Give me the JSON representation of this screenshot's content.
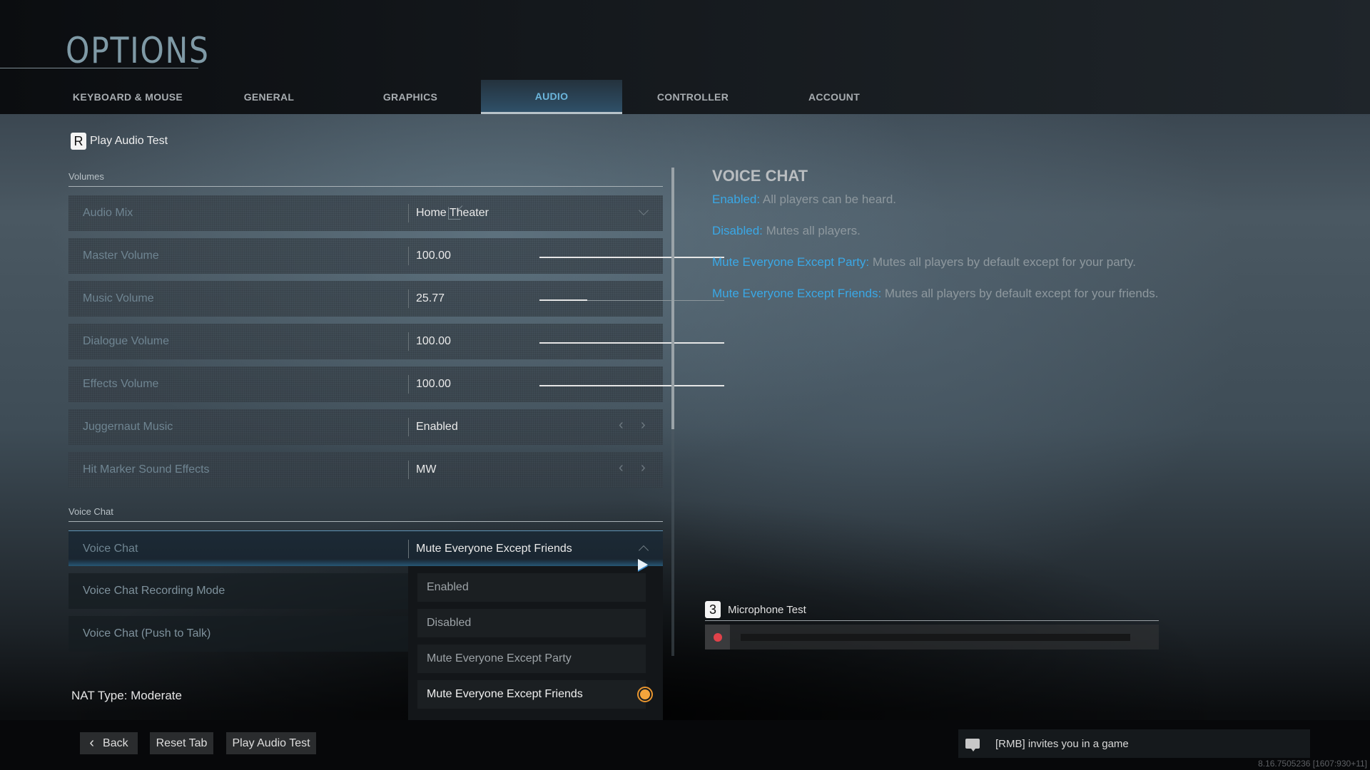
{
  "header": {
    "title": "OPTIONS"
  },
  "tabs": [
    {
      "label": "KEYBOARD & MOUSE",
      "active": false
    },
    {
      "label": "GENERAL",
      "active": false
    },
    {
      "label": "GRAPHICS",
      "active": false
    },
    {
      "label": "AUDIO",
      "active": true
    },
    {
      "label": "CONTROLLER",
      "active": false
    },
    {
      "label": "ACCOUNT",
      "active": false
    }
  ],
  "audio_test": {
    "key": "R",
    "label": "Play Audio Test"
  },
  "sections": {
    "volumes": "Volumes",
    "voice_chat": "Voice Chat"
  },
  "settings": {
    "audio_mix": {
      "label": "Audio Mix",
      "value": "Home Theater"
    },
    "master_volume": {
      "label": "Master Volume",
      "value": "100.00",
      "percent": 100
    },
    "music_volume": {
      "label": "Music Volume",
      "value": "25.77",
      "percent": 25.77
    },
    "dialogue_volume": {
      "label": "Dialogue Volume",
      "value": "100.00",
      "percent": 100
    },
    "effects_volume": {
      "label": "Effects Volume",
      "value": "100.00",
      "percent": 100
    },
    "juggernaut_music": {
      "label": "Juggernaut Music",
      "value": "Enabled"
    },
    "hit_marker": {
      "label": "Hit Marker Sound Effects",
      "value": "MW"
    },
    "voice_chat": {
      "label": "Voice Chat",
      "value": "Mute Everyone Except Friends"
    },
    "voice_chat_recording_mode": {
      "label": "Voice Chat Recording Mode"
    },
    "voice_chat_ptt": {
      "label": "Voice Chat (Push to Talk)"
    }
  },
  "dropdown": {
    "options": [
      "Enabled",
      "Disabled",
      "Mute Everyone Except Party",
      "Mute Everyone Except Friends"
    ],
    "selected": "Mute Everyone Except Friends"
  },
  "nat_type": "NAT Type: Moderate",
  "info": {
    "title": "VOICE CHAT",
    "items": [
      {
        "key": "Enabled:",
        "text": " All players can be heard."
      },
      {
        "key": "Disabled:",
        "text": " Mutes all players."
      },
      {
        "key": "Mute Everyone Except Party:",
        "text": " Mutes all players by default except for your party."
      },
      {
        "key": "Mute Everyone Except Friends:",
        "text": " Mutes all players by default except for your friends."
      }
    ]
  },
  "mic_test": {
    "key": "3",
    "label": "Microphone Test",
    "level_percent": 0
  },
  "footer": {
    "back": "Back",
    "reset_tab": "Reset Tab",
    "play_audio_test": "Play Audio Test",
    "notification": "[RMB] invites you in a game",
    "version": "8.16.7505236 [1607:930+11]"
  },
  "colors": {
    "accent": "#3aa8e6",
    "radio": "#f4a53c",
    "mic_record": "#e0424a"
  }
}
